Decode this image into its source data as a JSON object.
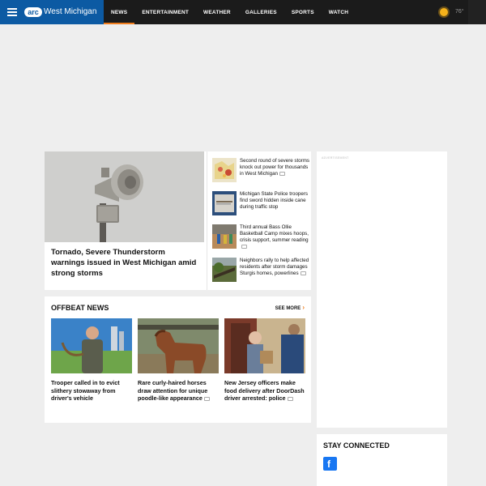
{
  "header": {
    "logo_mark": "arc",
    "logo_text": "West Michigan",
    "nav": [
      {
        "label": "NEWS",
        "active": true
      },
      {
        "label": "ENTERTAINMENT"
      },
      {
        "label": "WEATHER"
      },
      {
        "label": "GALLERIES"
      },
      {
        "label": "SPORTS"
      },
      {
        "label": "WATCH"
      }
    ],
    "weather": {
      "icon": "sun-icon",
      "temp": "76°"
    }
  },
  "hero": {
    "title": "Tornado, Severe Thunderstorm warnings issued in West Michigan amid strong storms",
    "image": "tornado-siren"
  },
  "stories": [
    {
      "title": "Second round of severe storms knock out power for thousands in West Michigan",
      "has_video": true
    },
    {
      "title": "Michigan State Police troopers find sword hidden inside cane during traffic stop",
      "has_video": false
    },
    {
      "title": "Third annual Bass Ollie Basketball Camp mixes hoops, crisis support, summer reading",
      "has_video": true
    },
    {
      "title": "Neighbors rally to help affected residents after storm damages Sturgis homes, powerlines",
      "has_video": true
    }
  ],
  "offbeat": {
    "title": "OFFBEAT NEWS",
    "see_more": "SEE MORE",
    "items": [
      {
        "title": "Trooper called in to evict slithery stowaway from driver's vehicle",
        "has_video": false
      },
      {
        "title": "Rare curly-haired horses draw attention for unique poodle-like appearance",
        "has_video": true
      },
      {
        "title": "New Jersey officers make food delivery after DoorDash driver arrested: police",
        "has_video": true
      }
    ]
  },
  "ad": {
    "label": "ADVERTISEMENT"
  },
  "stay_connected": {
    "title": "STAY CONNECTED",
    "social": [
      {
        "icon": "facebook-icon"
      }
    ]
  },
  "colors": {
    "brand": "#0c5aa3",
    "accent": "#f07d1d",
    "nav_bg": "#1b1b1b",
    "page_bg": "#eeeeee"
  }
}
